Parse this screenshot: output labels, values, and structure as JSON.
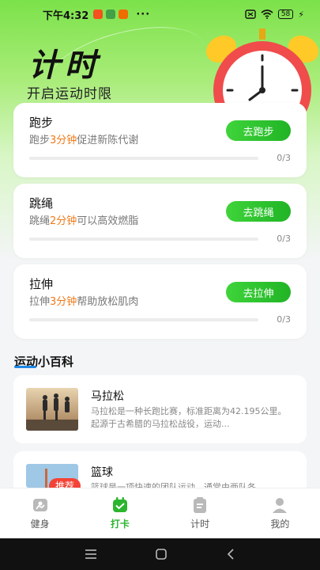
{
  "status_bar": {
    "time": "下午4:32",
    "dots": "···",
    "battery": "58"
  },
  "hero": {
    "title": "计时",
    "subtitle": "开启运动时限"
  },
  "tasks": [
    {
      "title": "跑步",
      "desc_pre": "跑步",
      "desc_hl": "3分钟",
      "desc_post": "促进新陈代谢",
      "button": "去跑步",
      "count": "0/3",
      "progress": 0
    },
    {
      "title": "跳绳",
      "desc_pre": "跳绳",
      "desc_hl": "2分钟",
      "desc_post": "可以高效燃脂",
      "button": "去跳绳",
      "count": "0/3",
      "progress": 0
    },
    {
      "title": "拉伸",
      "desc_pre": "拉伸",
      "desc_hl": "3分钟",
      "desc_post": "帮助放松肌肉",
      "button": "去拉伸",
      "count": "0/3",
      "progress": 0
    }
  ],
  "section": {
    "title": "运动小百科"
  },
  "articles": [
    {
      "title": "马拉松",
      "text": "马拉松是一种长跑比赛，标准距离为42.195公里。起源于古希腊的马拉松战役，运动..."
    },
    {
      "title": "篮球",
      "text": "篮球是一项快速的团队运动，通常由两队各..."
    }
  ],
  "badge": "推荐",
  "tabs": [
    {
      "label": "健身",
      "icon": "fitness-icon",
      "active": false
    },
    {
      "label": "打卡",
      "icon": "checkin-icon",
      "active": true
    },
    {
      "label": "计时",
      "icon": "timer-icon",
      "active": false
    },
    {
      "label": "我的",
      "icon": "profile-icon",
      "active": false
    }
  ],
  "colors": {
    "accent": "#2cb52f",
    "highlight": "#f07a1a",
    "badge": "#f44336"
  }
}
